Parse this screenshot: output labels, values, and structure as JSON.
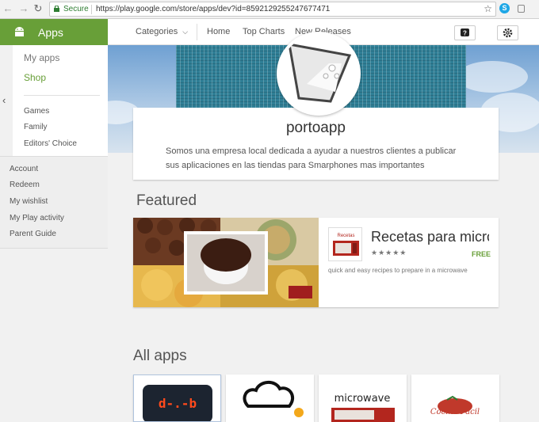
{
  "browser": {
    "secure_label": "Secure",
    "url": "https://play.google.com/store/apps/dev?id=8592129255247677471",
    "back_icon": "back-arrow-icon",
    "forward_icon": "forward-arrow-icon",
    "reload_icon": "reload-icon"
  },
  "header": {
    "section_label": "Apps",
    "nav": {
      "categories": "Categories",
      "home": "Home",
      "top_charts": "Top Charts",
      "new_releases": "New Releases"
    },
    "icons": [
      "help-icon",
      "settings-icon"
    ]
  },
  "sidebar": {
    "primary": [
      "My apps",
      "Shop"
    ],
    "categories": [
      "Games",
      "Family",
      "Editors' Choice"
    ],
    "account": [
      "Account",
      "Redeem",
      "My wishlist",
      "My Play activity",
      "Parent Guide"
    ]
  },
  "developer": {
    "name": "portoapp",
    "description_lines": [
      "Somos una empresa local dedicada a ayudar a nuestros clientes a publicar",
      "sus aplicaciones en las tiendas para Smarphones mas importantes"
    ]
  },
  "featured": {
    "title": "Featured",
    "app": {
      "name": "Recetas para microondas",
      "stars": "★★★★★",
      "price": "FREE",
      "description": "quick and easy recipes to prepare in a microwave",
      "thumb_title": "Recetas para microondas"
    }
  },
  "all_apps": {
    "title": "All apps",
    "cards": [
      {
        "label": "d-.-b"
      },
      {
        "label": ""
      },
      {
        "label": "microwave"
      },
      {
        "label": "Cocina Fácil"
      }
    ]
  },
  "colors": {
    "accent": "#689f38",
    "page_bg": "#f1f1f1"
  }
}
